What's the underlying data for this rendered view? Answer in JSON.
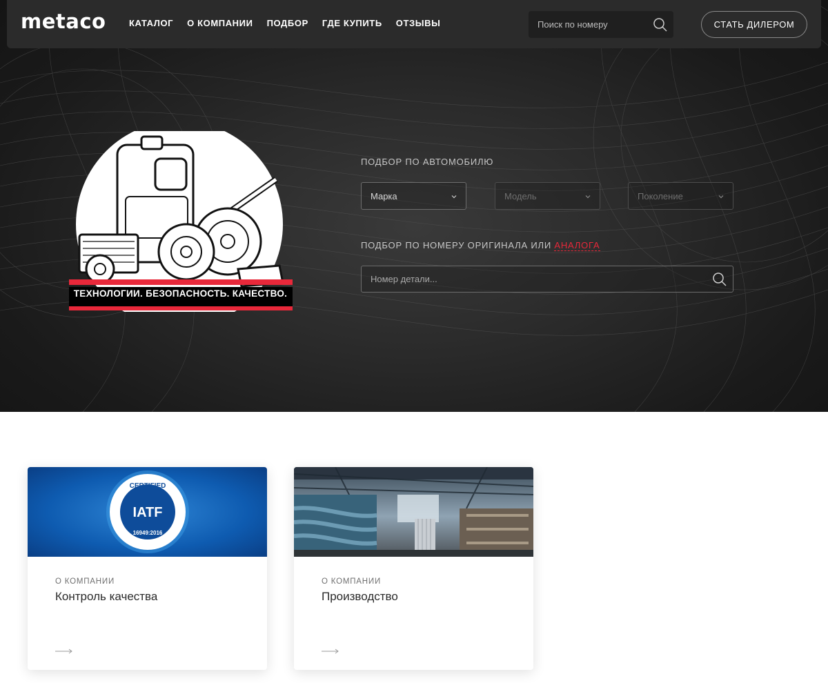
{
  "nav": {
    "logo": "metaco",
    "menu": [
      "КАТАЛОГ",
      "О КОМПАНИИ",
      "ПОДБОР",
      "ГДЕ КУПИТЬ",
      "ОТЗЫВЫ"
    ],
    "search_placeholder": "Поиск по номеру",
    "dealer_button": "СТАТЬ ДИЛЕРОМ"
  },
  "hero": {
    "promo_caption": "ТЕХНОЛОГИИ. БЕЗОПАСНОСТЬ. КАЧЕСТВО.",
    "by_car_title": "ПОДБОР ПО АВТОМОБИЛЮ",
    "make_select": "Марка",
    "model_select": "Модель",
    "generation_select": "Поколение",
    "by_number_title": "ПОДБОР ПО НОМЕРУ ОРИГИНАЛА ИЛИ",
    "by_number_link": "АНАЛОГА",
    "part_placeholder": "Номер детали..."
  },
  "cards": [
    {
      "category": "О КОМПАНИИ",
      "title": "Контроль качества",
      "badge_top": "CERTIFIED",
      "badge_mid": "IATF",
      "badge_bottom": "16949:2016"
    },
    {
      "category": "О КОМПАНИИ",
      "title": "Производство"
    }
  ],
  "colors": {
    "accent": "#e8283a",
    "nav_bg": "#2b2b2b",
    "hero_bg": "#222222",
    "badge_blue": "#0e4c9a"
  },
  "icons": [
    "search-icon",
    "chevron-down-icon",
    "arrow-right-icon"
  ]
}
